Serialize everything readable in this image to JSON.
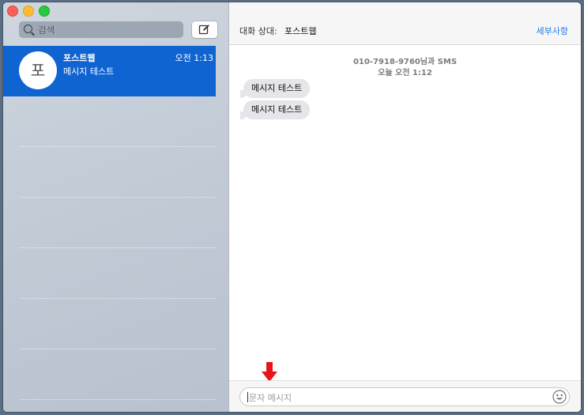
{
  "sidebar": {
    "search_placeholder": "검색",
    "conversations": [
      {
        "avatar_initial": "포",
        "name": "포스트웹",
        "time": "오전 1:13",
        "preview": "메시지 테스트",
        "selected": true
      }
    ]
  },
  "header": {
    "to_label": "대화 상대:",
    "to_name": "포스트웹",
    "details_label": "세부사항"
  },
  "thread": {
    "meta_line1": "010-7918-9760님과 SMS",
    "meta_line2": "오늘 오전 1:12",
    "messages": [
      "메시지 테스트",
      "메시지 테스트"
    ]
  },
  "composer": {
    "placeholder": "문자 메시지"
  },
  "colors": {
    "selection": "#0f64d2",
    "link": "#1f7ce8",
    "bubble": "#e5e5ea",
    "annotation_arrow": "#e8141b"
  },
  "icons": [
    "search-icon",
    "compose-icon",
    "emoji-icon",
    "down-arrow-icon"
  ]
}
